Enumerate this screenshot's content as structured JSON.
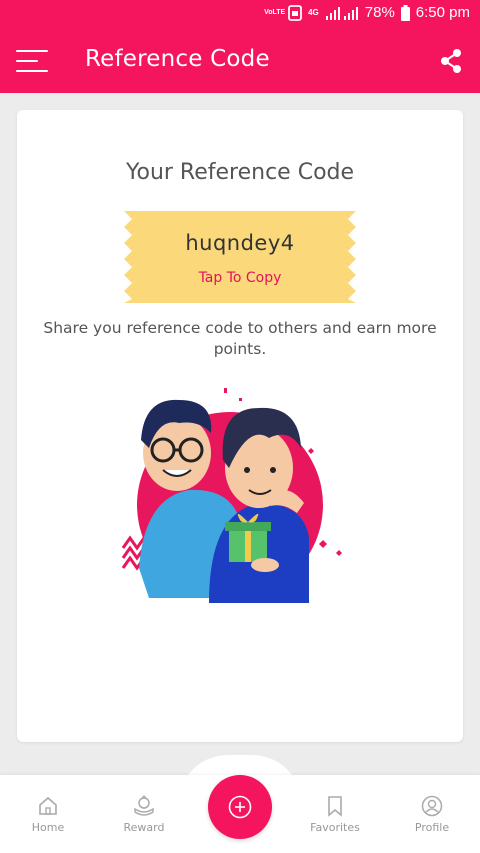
{
  "status_bar": {
    "volte": "VoLTE",
    "network": "4G",
    "battery": "78%",
    "time": "6:50 pm"
  },
  "app_bar": {
    "title": "Reference Code",
    "menu_icon": "hamburger-menu-icon",
    "share_icon": "share-icon"
  },
  "card": {
    "title": "Your Reference Code",
    "code": "huqndey4",
    "copy_label": "Tap To Copy",
    "description": "Share you reference code to others and earn more points."
  },
  "bottom_nav": {
    "items": [
      {
        "label": "Home",
        "icon": "home-icon"
      },
      {
        "label": "Reward",
        "icon": "reward-icon"
      },
      {
        "label": "Favorites",
        "icon": "bookmark-icon"
      },
      {
        "label": "Profile",
        "icon": "profile-icon"
      }
    ],
    "fab_icon": "plus-circle-icon"
  },
  "colors": {
    "primary": "#f5155e",
    "ticket": "#fbd97a",
    "copy_text": "#e0145a"
  }
}
